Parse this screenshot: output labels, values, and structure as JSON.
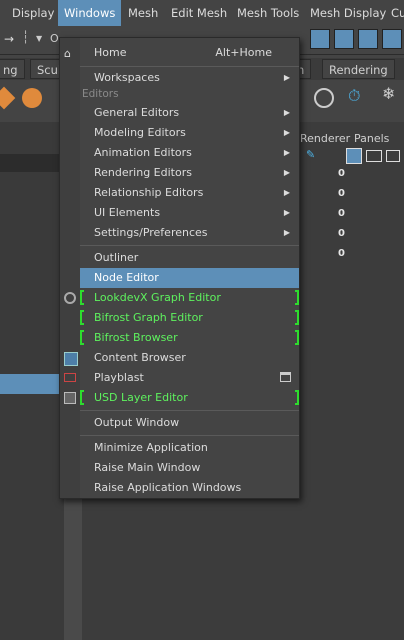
{
  "menubar": {
    "items": [
      "Display",
      "Windows",
      "Mesh",
      "Edit Mesh",
      "Mesh Tools",
      "Mesh Display",
      "Cu"
    ],
    "active_index": 1
  },
  "toolbar": {
    "field_fragment": "O"
  },
  "shelf": {
    "tabs": [
      "ng",
      "Scul",
      "n",
      "Rendering"
    ]
  },
  "panel": {
    "headers": [
      "Renderer",
      "Panels"
    ],
    "zeros": [
      "0",
      "0",
      "0",
      "0",
      "0"
    ]
  },
  "menu": {
    "home": {
      "label": "Home",
      "shortcut": "Alt+Home"
    },
    "workspaces": "Workspaces",
    "section_editors": "Editors",
    "editors": [
      "General Editors",
      "Modeling Editors",
      "Animation Editors",
      "Rendering Editors",
      "Relationship Editors",
      "UI Elements",
      "Settings/Preferences"
    ],
    "outliner": "Outliner",
    "node_editor": "Node Editor",
    "lookdevx": "LookdevX Graph Editor",
    "bifrost_graph": "Bifrost Graph Editor",
    "bifrost_browser": "Bifrost Browser",
    "content_browser": "Content Browser",
    "playblast": "Playblast",
    "usd_layer": "USD Layer Editor",
    "output_window": "Output Window",
    "minimize": "Minimize Application",
    "raise_main": "Raise Main Window",
    "raise_app": "Raise Application Windows"
  },
  "colors": {
    "menu_bg": "#444444",
    "highlight": "#5d8fb8",
    "plugin_green": "#5ef25e",
    "bracket_green": "#2edc2e"
  }
}
